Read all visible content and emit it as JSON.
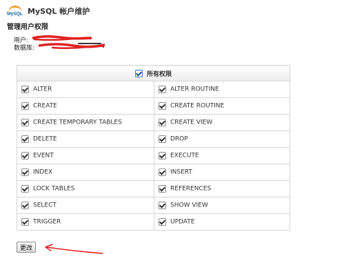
{
  "header": {
    "logo_text": "MySQL",
    "title": "MySQL 帐户维护"
  },
  "section_title": "管理用户权限",
  "user_label": "用户:",
  "db_label": "数据库:",
  "all_privileges_label": "所有权限",
  "privileges": [
    [
      "ALTER",
      "ALTER ROUTINE"
    ],
    [
      "CREATE",
      "CREATE ROUTINE"
    ],
    [
      "CREATE TEMPORARY TABLES",
      "CREATE VIEW"
    ],
    [
      "DELETE",
      "DROP"
    ],
    [
      "EVENT",
      "EXECUTE"
    ],
    [
      "INDEX",
      "INSERT"
    ],
    [
      "LOCK TABLES",
      "REFERENCES"
    ],
    [
      "SELECT",
      "SHOW VIEW"
    ],
    [
      "TRIGGER",
      "UPDATE"
    ]
  ],
  "submit_label": "更改",
  "colors": {
    "annotation": "#e02020",
    "logo_blue": "#2b6fa8",
    "logo_orange": "#f0a030"
  }
}
